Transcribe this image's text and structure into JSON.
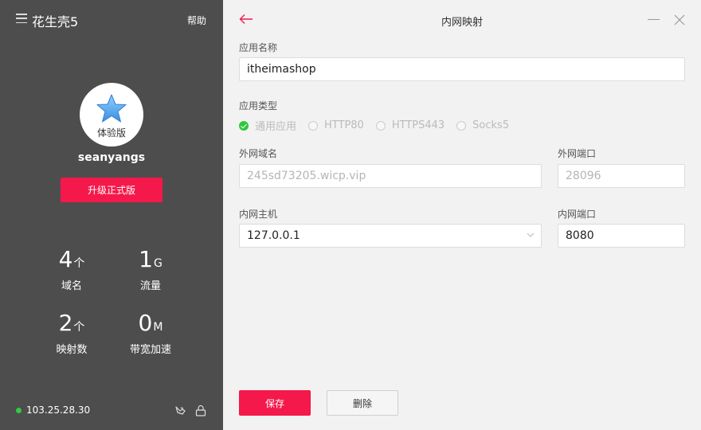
{
  "sidebar": {
    "app_title": "花生壳5",
    "help": "帮助",
    "avatar_label": "体验版",
    "username": "seanyangs",
    "upgrade": "升级正式版",
    "stats": [
      {
        "value": "4",
        "unit": "个",
        "label": "域名"
      },
      {
        "value": "1",
        "unit": "G",
        "label": "流量"
      },
      {
        "value": "2",
        "unit": "个",
        "label": "映射数"
      },
      {
        "value": "0",
        "unit": "M",
        "label": "带宽加速"
      }
    ],
    "ip": "103.25.28.30"
  },
  "main": {
    "title": "内网映射",
    "app_name_label": "应用名称",
    "app_name": "itheimashop",
    "app_type_label": "应用类型",
    "app_types": [
      "通用应用",
      "HTTP80",
      "HTTPS443",
      "Socks5"
    ],
    "selected_type": "通用应用",
    "ext_domain_label": "外网域名",
    "ext_domain": "245sd73205.wicp.vip",
    "ext_port_label": "外网端口",
    "ext_port": "28096",
    "int_host_label": "内网主机",
    "int_host": "127.0.0.1",
    "int_port_label": "内网端口",
    "int_port": "8080",
    "save": "保存",
    "delete": "删除"
  },
  "colors": {
    "accent": "#f5184a",
    "sidebar_bg": "#4d4d4d",
    "main_bg": "#f2f2f2",
    "online": "#2ecc40"
  }
}
